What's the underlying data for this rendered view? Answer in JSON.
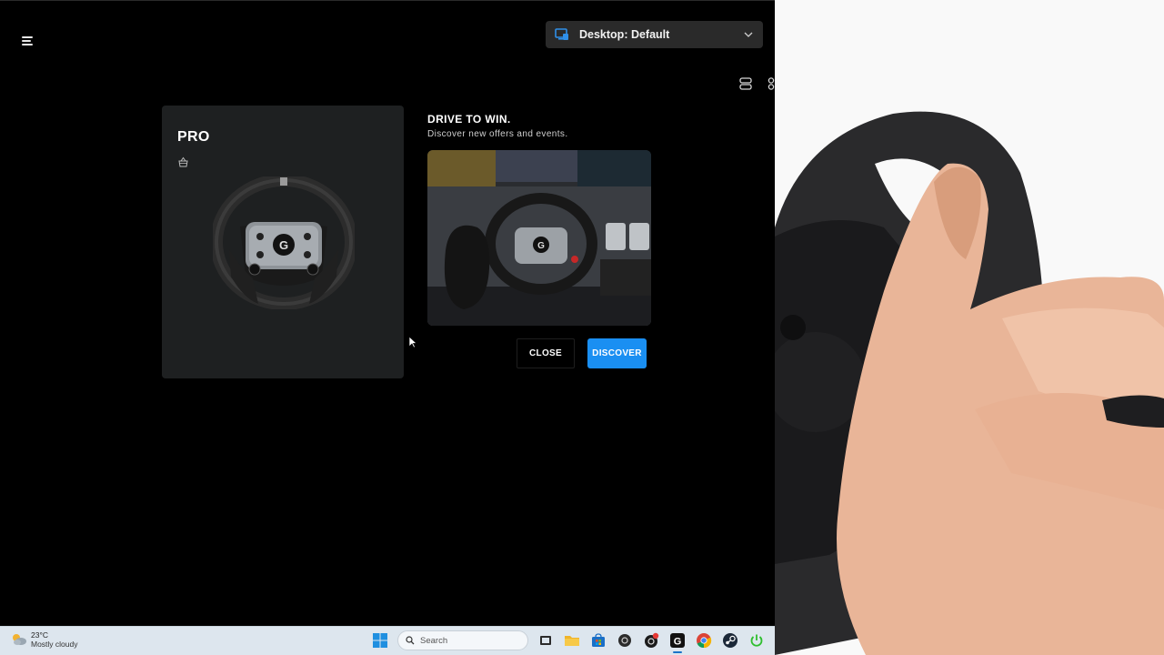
{
  "header": {
    "profile_label": "Desktop: Default"
  },
  "device": {
    "name": "PRO"
  },
  "promo": {
    "title": "DRIVE TO WIN.",
    "subtitle": "Discover new offers and events.",
    "close_label": "CLOSE",
    "discover_label": "DISCOVER",
    "accent_color": "#1a8ff2"
  },
  "taskbar": {
    "weather_temp": "23°C",
    "weather_condition": "Mostly cloudy",
    "search_placeholder": "Search",
    "apps": [
      "start-icon",
      "search",
      "task-view-icon",
      "file-explorer-icon",
      "store-icon",
      "app-icon",
      "app-notification-icon",
      "g-hub-icon",
      "chrome-icon",
      "steam-icon",
      "power-icon"
    ]
  }
}
